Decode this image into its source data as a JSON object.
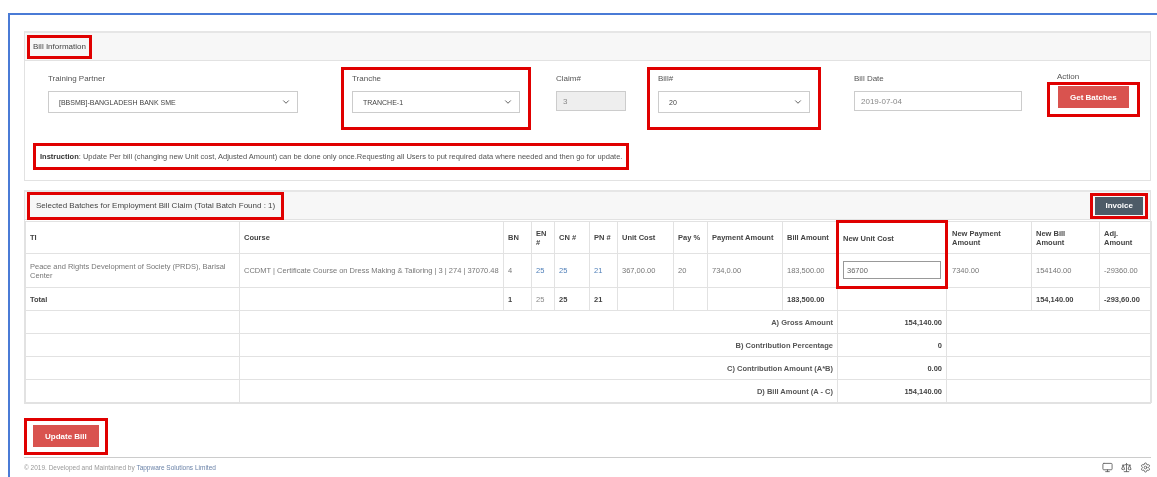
{
  "bill_information": {
    "title": "Bill Information",
    "highlighted": true,
    "fields": [
      {
        "kind": "select",
        "label": "Training Partner",
        "value": "[BBSMB]-BANGLADESH BANK SME",
        "highlighted": false
      },
      {
        "kind": "select",
        "label": "Tranche",
        "value": "TRANCHE-1",
        "highlighted": true
      },
      {
        "kind": "readonly",
        "label": "Claim#",
        "value": "3",
        "highlighted": false
      },
      {
        "kind": "select",
        "label": "Bill#",
        "value": "20",
        "highlighted": true
      },
      {
        "kind": "text",
        "label": "Bill Date",
        "value": "2019-07-04",
        "highlighted": false
      },
      {
        "kind": "button",
        "label": "Action",
        "value": "Get Batches",
        "highlighted": true
      }
    ],
    "instruction": {
      "text": "**Instruction**: Update Per bill (changing new Unit cost, Adjusted Amount) can be done only once.Requesting all Users to put required data where needed and then go for update.",
      "highlighted": true
    }
  },
  "batches": {
    "title": "Selected Batches for Employment Bill Claim (Total Batch Found : 1)",
    "highlighted": true,
    "invoice_button": {
      "label": "Invoice",
      "highlighted": true
    },
    "columns": [
      {
        "label": "TI",
        "highlighted": false
      },
      {
        "label": "Course",
        "highlighted": false
      },
      {
        "label": "BN",
        "highlighted": false
      },
      {
        "label": "EN #",
        "highlighted": false
      },
      {
        "label": "CN #",
        "highlighted": false
      },
      {
        "label": "PN #",
        "highlighted": false
      },
      {
        "label": "Unit Cost",
        "highlighted": false
      },
      {
        "label": "Pay %",
        "highlighted": false
      },
      {
        "label": "Payment Amount",
        "highlighted": false
      },
      {
        "label": "Bill Amount",
        "highlighted": false
      },
      {
        "label": "New Unit Cost",
        "highlighted": true
      },
      {
        "label": "New Payment Amount",
        "highlighted": false
      },
      {
        "label": "New Bill Amount",
        "highlighted": false
      },
      {
        "label": "Adj. Amount",
        "highlighted": false
      }
    ],
    "rows": [
      {
        "cells": [
          {
            "kind": "text",
            "text": "Peace and Rights Development of Society (PRDS), Barisal Center"
          },
          {
            "kind": "text",
            "text": "CCDMT | Certificate Course on Dress Making & Tailoring | 3 | 274 | 37070.48"
          },
          {
            "kind": "text",
            "text": "4"
          },
          {
            "kind": "link",
            "text": "25"
          },
          {
            "kind": "link",
            "text": "25"
          },
          {
            "kind": "link",
            "text": "21"
          },
          {
            "kind": "text",
            "text": "367,00.00"
          },
          {
            "kind": "text",
            "text": "20"
          },
          {
            "kind": "text",
            "text": "734,0.00"
          },
          {
            "kind": "text",
            "text": "183,500.00"
          },
          {
            "kind": "input",
            "text": "36700"
          },
          {
            "kind": "text",
            "text": "7340.00"
          },
          {
            "kind": "text",
            "text": "154140.00"
          },
          {
            "kind": "text",
            "text": "-29360.00"
          }
        ]
      }
    ],
    "total": [
      {
        "kind": "bold",
        "text": "Total"
      },
      {
        "kind": "empty"
      },
      {
        "kind": "bold",
        "text": "1"
      },
      {
        "kind": "plain",
        "text": "25"
      },
      {
        "kind": "bold",
        "text": "25"
      },
      {
        "kind": "bold",
        "text": "21"
      },
      {
        "kind": "empty"
      },
      {
        "kind": "empty"
      },
      {
        "kind": "empty"
      },
      {
        "kind": "bold",
        "text": "183,500.00"
      },
      {
        "kind": "empty"
      },
      {
        "kind": "empty"
      },
      {
        "kind": "bold",
        "text": "154,140.00"
      },
      {
        "kind": "bold",
        "text": "-293,60.00"
      }
    ],
    "summary": [
      {
        "label": "A) Gross Amount",
        "value": "154,140.00"
      },
      {
        "label": "B) Contribution Percentage",
        "value": "0"
      },
      {
        "label": "C) Contribution Amount (A*B)",
        "value": "0.00"
      },
      {
        "label": "D) Bill Amount (A - C)",
        "value": "154,140.00"
      }
    ]
  },
  "update_button": {
    "label": "Update Bill",
    "highlighted": true
  },
  "footer": {
    "text": "© 2019. Developed and Maintained by",
    "link": "Tappware Solutions Limited"
  }
}
